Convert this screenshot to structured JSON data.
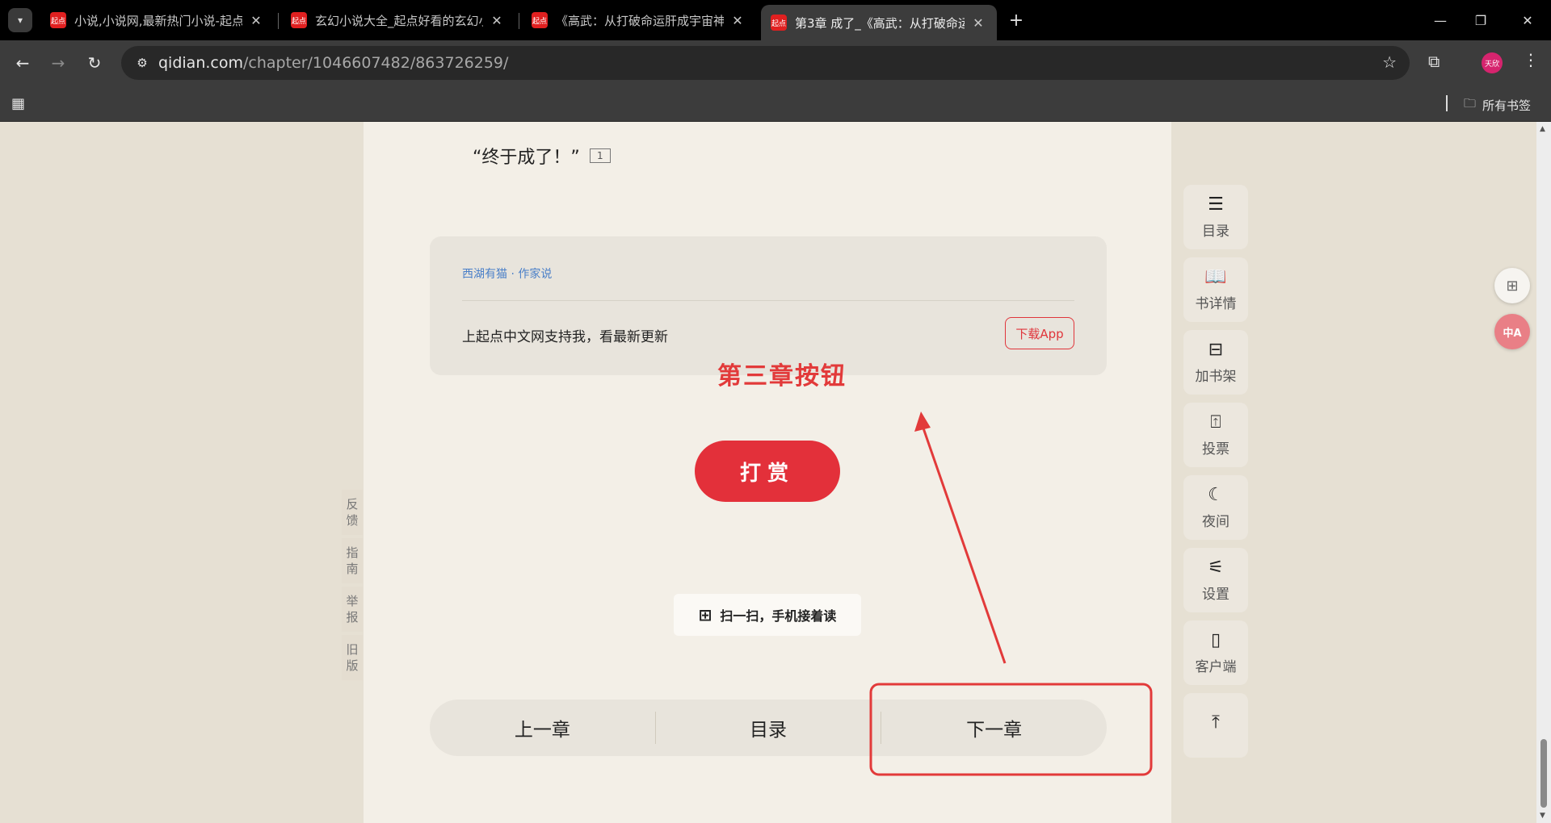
{
  "browser": {
    "tabs": [
      {
        "title": "小说,小说网,最新热门小说-起点",
        "favicon": "起点"
      },
      {
        "title": "玄幻小说大全_起点好看的玄幻小",
        "favicon": "起点"
      },
      {
        "title": "《高武：从打破命运肝成宇宙神",
        "favicon": "起点"
      },
      {
        "title": "第3章 成了_《高武：从打破命运",
        "favicon": "起点"
      }
    ],
    "url_host": "qidian.com",
    "url_path": "/chapter/1046607482/863726259/",
    "profile_label": "天欣",
    "bookmarks_all": "所有书签"
  },
  "reader": {
    "last_line": "“终于成了！”",
    "note_count": "1",
    "author_name": "西湖有猫 · 作家说",
    "author_text": "上起点中文网支持我，看最新更新",
    "download_label": "下载App",
    "reward_label": "打赏",
    "scan_label": "扫一扫，手机接着读",
    "nav": {
      "prev": "上一章",
      "toc": "目录",
      "next": "下一章"
    }
  },
  "annotation": {
    "label": "第三章按钮",
    "color": "#e23a3a"
  },
  "side_feedback": [
    {
      "line1": "反",
      "line2": "馈"
    },
    {
      "line1": "指",
      "line2": "南"
    },
    {
      "line1": "举",
      "line2": "报"
    },
    {
      "line1": "旧",
      "line2": "版"
    }
  ],
  "right_rail": [
    {
      "label": "目录",
      "icon": "list-icon"
    },
    {
      "label": "书详情",
      "icon": "book-icon"
    },
    {
      "label": "加书架",
      "icon": "bookshelf-add-icon"
    },
    {
      "label": "投票",
      "icon": "ticket-icon"
    },
    {
      "label": "夜间",
      "icon": "moon-icon"
    },
    {
      "label": "设置",
      "icon": "sliders-icon"
    },
    {
      "label": "客户端",
      "icon": "phone-icon"
    },
    {
      "label": "",
      "icon": "back-to-top-icon"
    }
  ],
  "colors": {
    "accent": "#e3303a",
    "link": "#4a7fc8",
    "reader_bg": "#f3efe7"
  }
}
